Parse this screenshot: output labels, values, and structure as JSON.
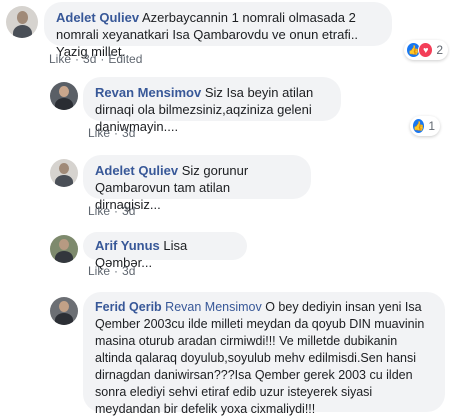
{
  "colors": {
    "link": "#385898",
    "bubble": "#f2f3f5",
    "meta": "#606770",
    "like_blue": "#1877f2",
    "love_red": "#f33e58"
  },
  "comments": [
    {
      "author": "Adelet Quliev",
      "text": "Azerbaycannin 1 nomrali olmasada 2 nomrali xeyanatkari Isa Qambarovdu ve onun etrafi.. Yazig millet.",
      "like": "Like",
      "time": "3d",
      "edited": "Edited",
      "reactions": {
        "icons": [
          "like-icon",
          "love-icon"
        ],
        "count": "2"
      }
    },
    {
      "author": "Revan Mensimov",
      "text": "Siz Isa beyin atilan dirnaqi ola bilmezsiniz,aqziniza geleni daniwmayin....",
      "like": "Like",
      "time": "3d",
      "reactions": {
        "icons": [
          "like-icon"
        ],
        "count": "1"
      }
    },
    {
      "author": "Adelet Quliev",
      "text": "Siz gorunur Qambarovun tam atilan dirnagisiz...",
      "like": "Like",
      "time": "3d"
    },
    {
      "author": "Arif Yunus",
      "text": "Lisa Qəmbər...",
      "like": "Like",
      "time": "3d"
    },
    {
      "author": "Ferid Qerib",
      "mention": "Revan Mensimov",
      "text": "O bey dediyin insan yeni Isa Qember 2003cu ilde milleti meydan da qoyub DIN muavinin masina oturub aradan cirmiwdi!!! Ve milletde dubikanin altinda qalaraq doyulub,soyulub mehv edilmisdi.Sen hansi dirnagdan daniwirsan???Isa Qember gerek 2003 cu ilden sonra elediyi sehvi etiraf edib uzur isteyerek siyasi meydandan bir defelik yoxa cixmaliydi!!!"
    }
  ]
}
